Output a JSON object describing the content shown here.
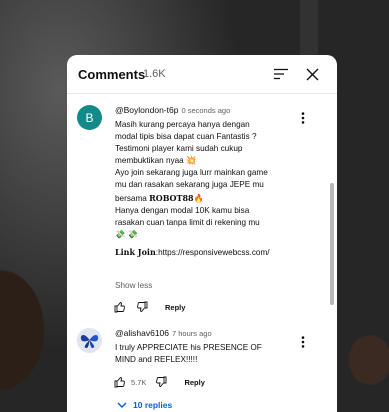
{
  "header": {
    "title": "Comments",
    "count": "1.6K"
  },
  "icons": {
    "sort": "sort-icon",
    "close": "close-icon",
    "more": "more-vert-icon",
    "like": "thumb-up-icon",
    "dislike": "thumb-down-icon",
    "expand": "chevron-down-icon"
  },
  "colors": {
    "avatar_1": "#138a8a",
    "reply_link": "#065fd4"
  },
  "comments": [
    {
      "avatar_letter": "B",
      "author": "@Boylondon-t6p",
      "time": "0 seconds ago",
      "lines": [
        "Masih kurang percaya hanya dengan",
        "modal tipis bisa dapat cuan Fantastis ?",
        "Testimoni player kami sudah cukup",
        "membuktikan nyaa 💥",
        "Ayo join sekarang juga lurr mainkan game",
        "mu dan rasakan sekarang juga JEPE mu",
        "bersama",
        "Hanya dengan modal 10K kamu bisa",
        "rasakan cuan tanpa limit di rekening mu",
        "💸 💸"
      ],
      "brand": "𝐑𝐎𝐁𝐎𝐓𝟖𝟖",
      "brand_emoji": "🔥",
      "link_label": "𝐋𝐢𝐧𝐤 𝐉𝐨𝐢𝐧",
      "link_url": ":https://responsivewebcss.com/",
      "show_less": "Show less",
      "reply": "Reply"
    },
    {
      "author": "@alishav6106",
      "time": "7 hours ago",
      "lines": [
        "I truly APPRECIATE his PRESENCE OF",
        "MIND and  REFLEX!!!!!"
      ],
      "likes": "5.7K",
      "reply": "Reply",
      "replies": "10 replies"
    }
  ]
}
